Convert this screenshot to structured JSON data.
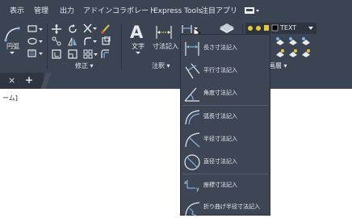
{
  "menubar": {
    "items": [
      {
        "label": "表示"
      },
      {
        "label": "管理"
      },
      {
        "label": "出力"
      },
      {
        "label": "アドイン"
      },
      {
        "label": "コラボレート"
      },
      {
        "label": "Express Tools"
      },
      {
        "label": "注目アプリ"
      }
    ]
  },
  "ribbon": {
    "draw": {
      "arc_label": "円弧"
    },
    "modify": {
      "panel_label": "修正 ▾"
    },
    "annotation": {
      "text_label": "文字",
      "dimension_label": "寸法記入",
      "panel_label": "注釈 ▾"
    },
    "layers": {
      "layer_name": "TEXT",
      "panel_label": "画層 ▾"
    },
    "colors": {
      "accent_yellow": "#e8c63a",
      "icon_blue": "#7fb2e5"
    }
  },
  "tabs": {
    "close_symbol": "×",
    "add_symbol": "+"
  },
  "drawing": {
    "fragment_text": "ーム]"
  },
  "dimension_menu": {
    "items": [
      {
        "label": "長さ寸法記入",
        "icon": "linear-dimension-icon"
      },
      {
        "label": "平行寸法記入",
        "icon": "aligned-dimension-icon"
      },
      {
        "label": "角度寸法記入",
        "icon": "angular-dimension-icon"
      },
      {
        "label": "弧長寸法記入",
        "icon": "arc-length-dimension-icon"
      },
      {
        "label": "半径寸法記入",
        "icon": "radius-dimension-icon"
      },
      {
        "label": "直径寸法記入",
        "icon": "diameter-dimension-icon"
      },
      {
        "label": "座標寸法記入",
        "icon": "ordinate-dimension-icon"
      },
      {
        "label": "折り曲げ半径寸法記入",
        "icon": "jogged-radius-dimension-icon"
      }
    ]
  }
}
